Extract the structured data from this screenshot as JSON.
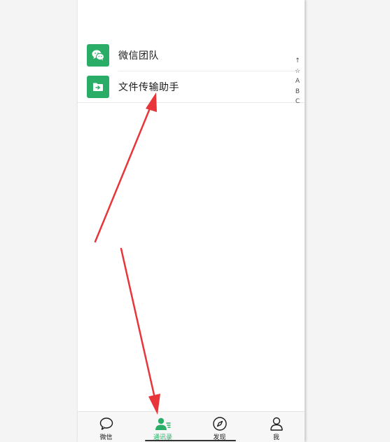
{
  "contacts": [
    {
      "name": "微信团队",
      "icon": "wechat-logo-icon"
    },
    {
      "name": "文件传输助手",
      "icon": "file-transfer-icon"
    }
  ],
  "index_bar": [
    "↑",
    "☆",
    "A",
    "B",
    "C"
  ],
  "tabbar": {
    "tabs": [
      {
        "label": "微信",
        "icon": "chat-bubble-icon"
      },
      {
        "label": "通讯录",
        "icon": "contacts-icon",
        "active": true
      },
      {
        "label": "发现",
        "icon": "compass-icon"
      },
      {
        "label": "我",
        "icon": "person-icon"
      }
    ]
  },
  "colors": {
    "accent": "#2aae67",
    "annotation_arrow": "#e8353a"
  }
}
